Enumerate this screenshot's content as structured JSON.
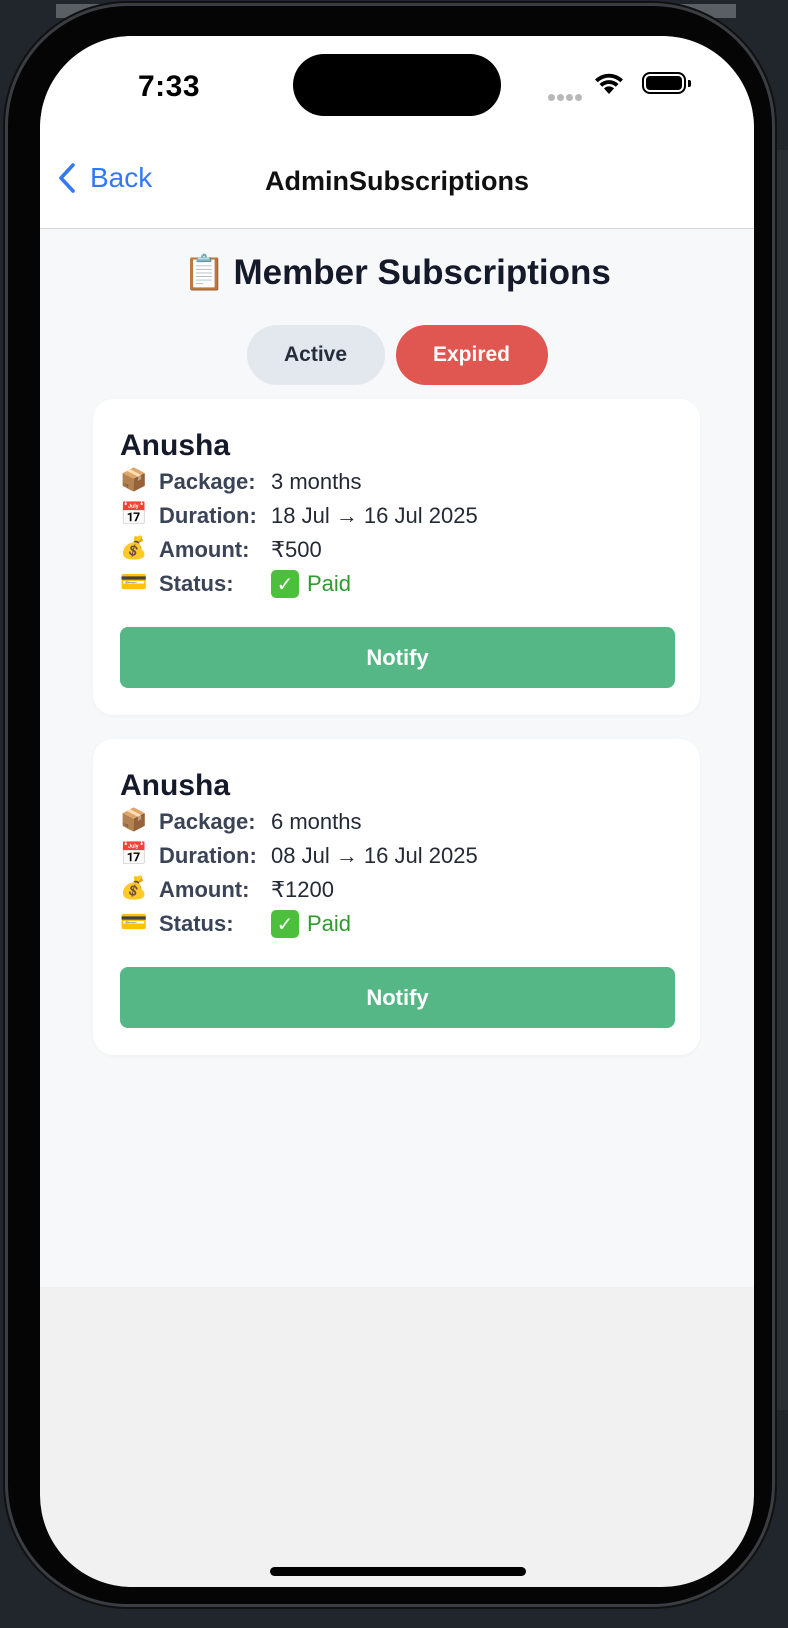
{
  "status_bar": {
    "time": "7:33"
  },
  "nav": {
    "back_label": "Back",
    "title": "AdminSubscriptions"
  },
  "page": {
    "title": "Member Subscriptions"
  },
  "tabs": {
    "active_label": "Active",
    "expired_label": "Expired",
    "selected": "Expired"
  },
  "labels": {
    "package": "Package:",
    "duration": "Duration:",
    "amount": "Amount:",
    "status": "Status:"
  },
  "subscriptions": [
    {
      "name": "Anusha",
      "package": "3 months",
      "duration": "18 Jul → 16 Jul 2025",
      "amount": "₹500",
      "status": "Paid",
      "button": "Notify"
    },
    {
      "name": "Anusha",
      "package": "6 months",
      "duration": "08 Jul → 16 Jul 2025",
      "amount": "₹1200",
      "status": "Paid",
      "button": "Notify"
    }
  ],
  "icons": {
    "package": "package-icon",
    "duration": "calendar-icon",
    "amount": "money-bag-icon",
    "status": "credit-card-icon",
    "title": "clipboard-icon"
  },
  "colors": {
    "accent_blue": "#3478f6",
    "expired_tab": "#e05650",
    "notify_button": "#55b785",
    "paid_text": "#2f9a2f"
  }
}
